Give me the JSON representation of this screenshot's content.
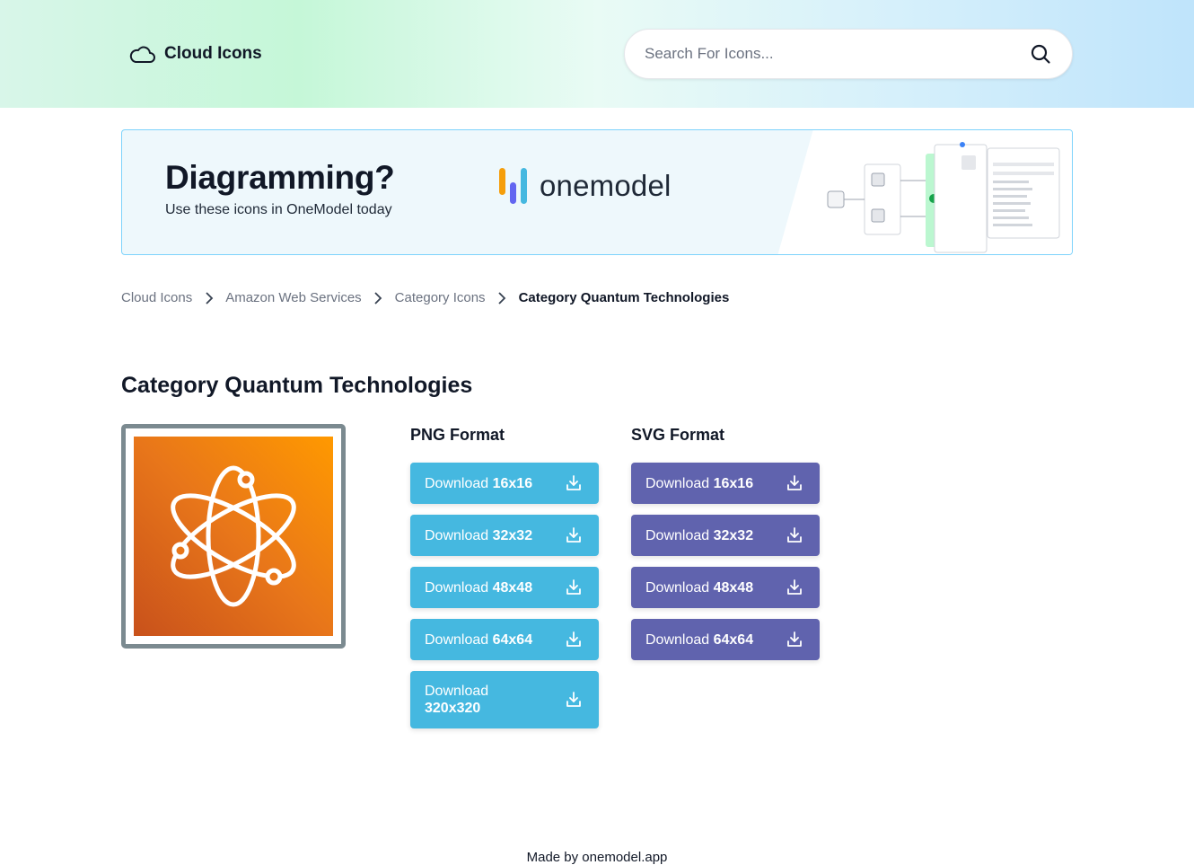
{
  "header": {
    "brand": "Cloud Icons",
    "search_placeholder": "Search For Icons..."
  },
  "banner": {
    "title": "Diagramming?",
    "subtitle": "Use these icons in OneModel today",
    "logo_text": "onemodel",
    "logo_colors": [
      "#f59e0b",
      "#6366f1",
      "#45b8e0"
    ]
  },
  "breadcrumb": {
    "items": [
      "Cloud Icons",
      "Amazon Web Services",
      "Category Icons"
    ],
    "current": "Category Quantum Technologies"
  },
  "page": {
    "title": "Category Quantum Technologies",
    "icon_name": "atom-icon"
  },
  "png": {
    "title": "PNG Format",
    "buttons": [
      {
        "prefix": "Download",
        "size": "16x16"
      },
      {
        "prefix": "Download",
        "size": "32x32"
      },
      {
        "prefix": "Download",
        "size": "48x48"
      },
      {
        "prefix": "Download",
        "size": "64x64"
      },
      {
        "prefix": "Download",
        "size": "320x320"
      }
    ]
  },
  "svg": {
    "title": "SVG Format",
    "buttons": [
      {
        "prefix": "Download",
        "size": "16x16"
      },
      {
        "prefix": "Download",
        "size": "32x32"
      },
      {
        "prefix": "Download",
        "size": "48x48"
      },
      {
        "prefix": "Download",
        "size": "64x64"
      }
    ]
  },
  "footer": {
    "text": "Made by onemodel.app"
  },
  "colors": {
    "png_button": "#45b8e0",
    "svg_button": "#6063ae",
    "icon_gradient_start": "#c8511b",
    "icon_gradient_end": "#ff9900"
  }
}
